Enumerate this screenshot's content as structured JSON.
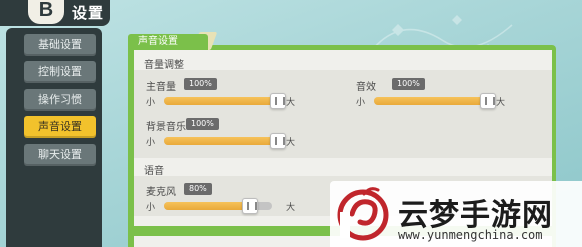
{
  "header": {
    "logo_glyph": "B",
    "title": "设置"
  },
  "sidebar": {
    "items": [
      {
        "label": "基础设置",
        "active": false
      },
      {
        "label": "控制设置",
        "active": false
      },
      {
        "label": "操作习惯",
        "active": false
      },
      {
        "label": "声音设置",
        "active": true
      },
      {
        "label": "聊天设置",
        "active": false
      }
    ]
  },
  "panel": {
    "tab_label": "声音设置",
    "sections": [
      {
        "title": "音量调整",
        "sliders": [
          {
            "label": "主音量",
            "value_text": "100%",
            "value": 100,
            "min_label": "小",
            "max_label": "大"
          },
          {
            "label": "音效",
            "value_text": "100%",
            "value": 100,
            "min_label": "小",
            "max_label": "大"
          },
          {
            "label": "背景音乐",
            "value_text": "100%",
            "value": 100,
            "min_label": "小",
            "max_label": "大"
          }
        ]
      },
      {
        "title": "语音",
        "sliders": [
          {
            "label": "麦克风",
            "value_text": "80%",
            "value": 80,
            "min_label": "小",
            "max_label": "大"
          }
        ]
      }
    ]
  },
  "watermark": {
    "name": "云梦手游网",
    "url": "www.yunmengchina.com"
  },
  "colors": {
    "accent": "#f2c22c",
    "panel_border": "#7bc04a",
    "slider_fill": "#eeb448",
    "sidebar_bg": "#2f3b3d",
    "watermark_red": "#c0262c"
  }
}
